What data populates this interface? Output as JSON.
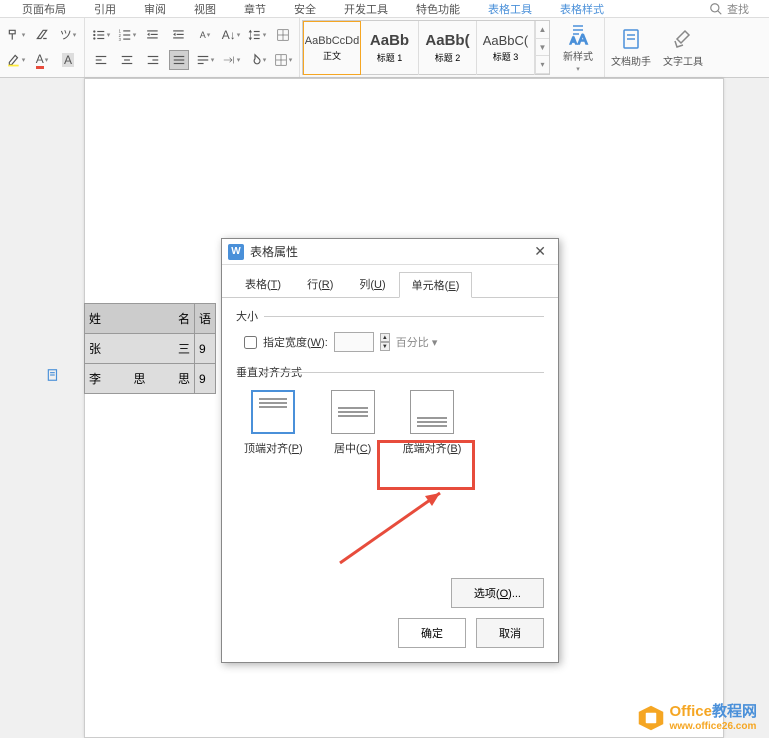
{
  "ribbon_tabs": [
    "页面布局",
    "引用",
    "审阅",
    "视图",
    "章节",
    "安全",
    "开发工具",
    "特色功能",
    "表格工具",
    "表格样式"
  ],
  "search_placeholder": "查找",
  "styles": [
    {
      "preview": "AaBbCcDd",
      "label": "正文"
    },
    {
      "preview": "AaBb",
      "label": "标题 1"
    },
    {
      "preview": "AaBb(",
      "label": "标题 2"
    },
    {
      "preview": "AaBbC(",
      "label": "标题 3"
    }
  ],
  "large_buttons": {
    "new_style": "新样式",
    "doc_assist": "文档助手",
    "text_tool": "文字工具"
  },
  "table_data": {
    "headers": [
      "姓          名",
      "语",
      ""
    ],
    "rows": [
      [
        "张          三",
        "9",
        ""
      ],
      [
        "李   思   思",
        "9",
        ""
      ]
    ]
  },
  "dialog": {
    "title": "表格属性",
    "tabs": [
      {
        "label": "表格",
        "key": "T"
      },
      {
        "label": "行",
        "key": "R"
      },
      {
        "label": "列",
        "key": "U"
      },
      {
        "label": "单元格",
        "key": "E"
      }
    ],
    "size_label": "大小",
    "width_check": "指定宽度",
    "width_key": "W",
    "unit": "百分比",
    "valign_label": "垂直对齐方式",
    "aligns": [
      {
        "label": "顶端对齐",
        "key": "P"
      },
      {
        "label": "居中",
        "key": "C"
      },
      {
        "label": "底端对齐",
        "key": "B"
      }
    ],
    "options_btn": "选项",
    "options_key": "O",
    "ok": "确定",
    "cancel": "取消"
  },
  "watermark": {
    "brand_a": "Office",
    "brand_b": "教程网",
    "url": "www.office26.com"
  }
}
